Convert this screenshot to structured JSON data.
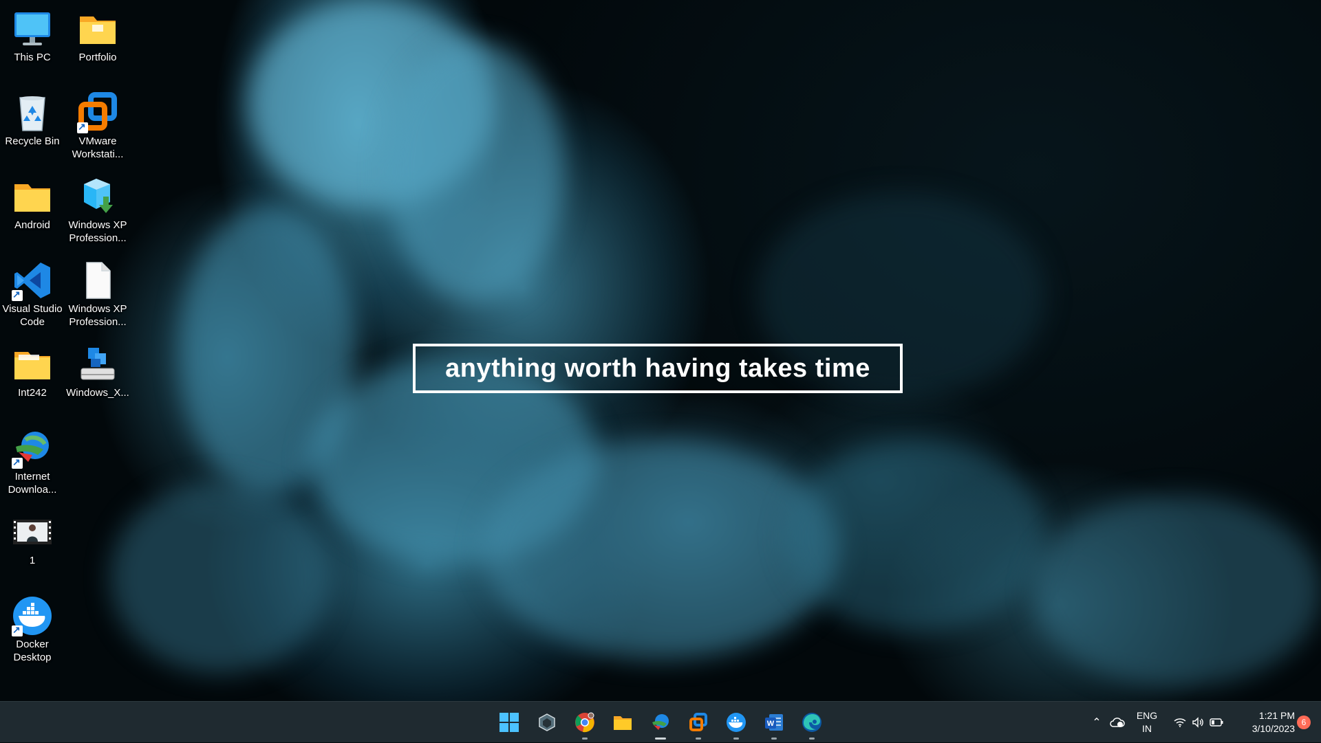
{
  "wallpaper": {
    "motto": "anything worth having takes time",
    "colors": {
      "smoke": "#3c8fb0",
      "background": "#02080b"
    }
  },
  "desktop_icons": [
    {
      "label": "This PC",
      "icon": "monitor-icon"
    },
    {
      "label": "Portfolio",
      "icon": "folder-icon"
    },
    {
      "label": "Recycle Bin",
      "icon": "recycle-bin-icon"
    },
    {
      "label": "VMware Workstati...",
      "icon": "vmware-icon"
    },
    {
      "label": "Android",
      "icon": "folder-icon"
    },
    {
      "label": "Windows XP Profession...",
      "icon": "install-package-icon"
    },
    {
      "label": "Visual Studio Code",
      "icon": "vscode-icon"
    },
    {
      "label": "Windows XP Profession...",
      "icon": "file-icon"
    },
    {
      "label": "Int242",
      "icon": "folder-icon"
    },
    {
      "label": "Windows_X...",
      "icon": "virtual-machine-icon"
    },
    {
      "label": "Internet Downloa...",
      "icon": "internet-download-manager-icon"
    },
    {
      "label": "1",
      "icon": "video-file-icon"
    },
    {
      "label": "Docker Desktop",
      "icon": "docker-icon"
    }
  ],
  "taskbar": {
    "apps": [
      {
        "name": "start",
        "icon": "windows-start-icon"
      },
      {
        "name": "app",
        "icon": "hexagon-app-icon"
      },
      {
        "name": "chrome",
        "icon": "chrome-icon"
      },
      {
        "name": "file-explorer",
        "icon": "file-explorer-icon"
      },
      {
        "name": "internet-download-manager",
        "icon": "internet-download-manager-icon"
      },
      {
        "name": "vmware",
        "icon": "vmware-icon"
      },
      {
        "name": "docker",
        "icon": "docker-icon"
      },
      {
        "name": "word",
        "icon": "word-icon"
      },
      {
        "name": "edge",
        "icon": "edge-icon"
      }
    ],
    "tray": {
      "language_line1": "ENG",
      "language_line2": "IN",
      "time": "1:21 PM",
      "date": "3/10/2023",
      "notification_count": "6"
    },
    "colors": {
      "background": "#1f2a30",
      "accent": "#2196f3"
    }
  }
}
